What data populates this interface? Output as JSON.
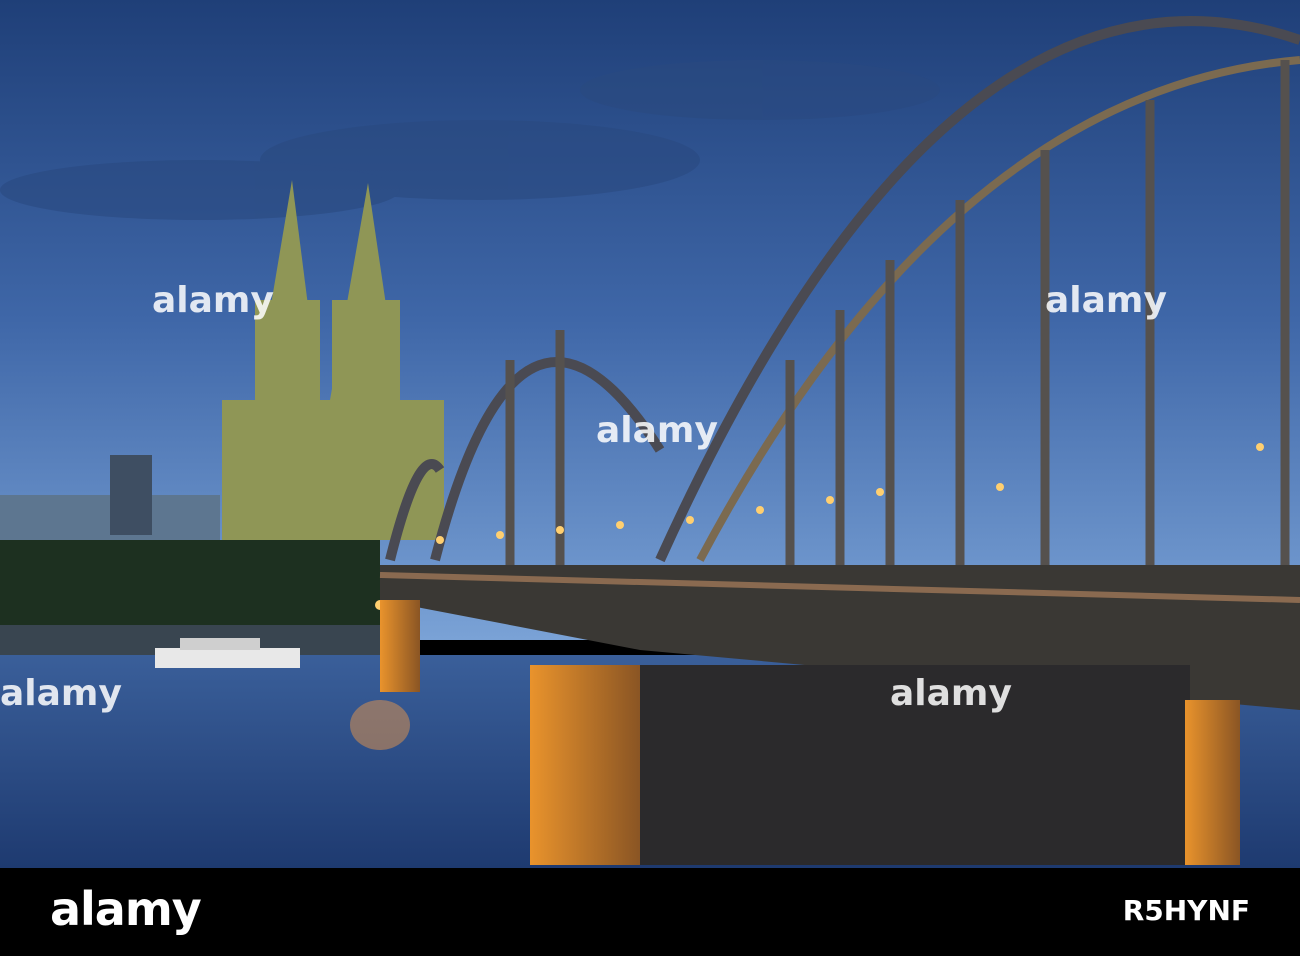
{
  "photo": {
    "subject": "Cologne Cathedral and Hohenzollern Bridge at dusk",
    "watermark": "alamy"
  },
  "footer": {
    "logo": "alamy",
    "image_id": "R5HYNF"
  },
  "colors": {
    "sky_top": "#1f3f78",
    "sky_bottom": "#6f97cf",
    "water": "#2d4f86",
    "light": "#ffb347",
    "steel": "#4a4a4f"
  }
}
